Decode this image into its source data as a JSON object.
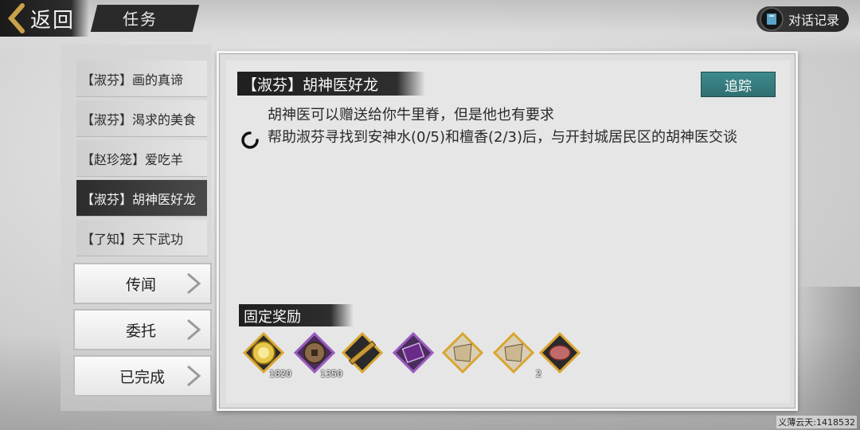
{
  "header": {
    "back_label": "返回",
    "title": "任务",
    "dialog_log_label": "对话记录"
  },
  "quest_list": [
    {
      "label": "【淑芬】画的真谛",
      "selected": false
    },
    {
      "label": "【淑芬】渴求的美食",
      "selected": false
    },
    {
      "label": "【赵珍笼】爱吃羊",
      "selected": false
    },
    {
      "label": "【淑芬】胡神医好龙",
      "selected": true
    },
    {
      "label": "【了知】天下武功",
      "selected": false
    }
  ],
  "categories": [
    {
      "label": "传闻"
    },
    {
      "label": "委托"
    },
    {
      "label": "已完成"
    }
  ],
  "quest": {
    "title": "【淑芬】胡神医好龙",
    "track_label": "追踪",
    "description": "胡神医可以赠送给你牛里脊，但是他也有要求",
    "objective": "帮助淑芬寻找到安神水(0/5)和檀香(2/3)后，与开封城居民区的胡神医交谈"
  },
  "rewards": {
    "title": "固定奖励",
    "items": [
      {
        "icon": "gold-coin-icon",
        "count": "1820",
        "frame": "gold"
      },
      {
        "icon": "copper-coin-icon",
        "count": "1350",
        "frame": "purple"
      },
      {
        "icon": "flute-icon",
        "count": "",
        "frame": "gold"
      },
      {
        "icon": "manual-book-icon",
        "count": "",
        "frame": "purple"
      },
      {
        "icon": "scroll-map-icon",
        "count": "",
        "frame": "gold"
      },
      {
        "icon": "scroll-map-icon",
        "count": "2",
        "frame": "gold"
      },
      {
        "icon": "beef-tenderloin-icon",
        "count": "",
        "frame": "gold"
      }
    ]
  },
  "watermark": "义薄云天:1418532"
}
